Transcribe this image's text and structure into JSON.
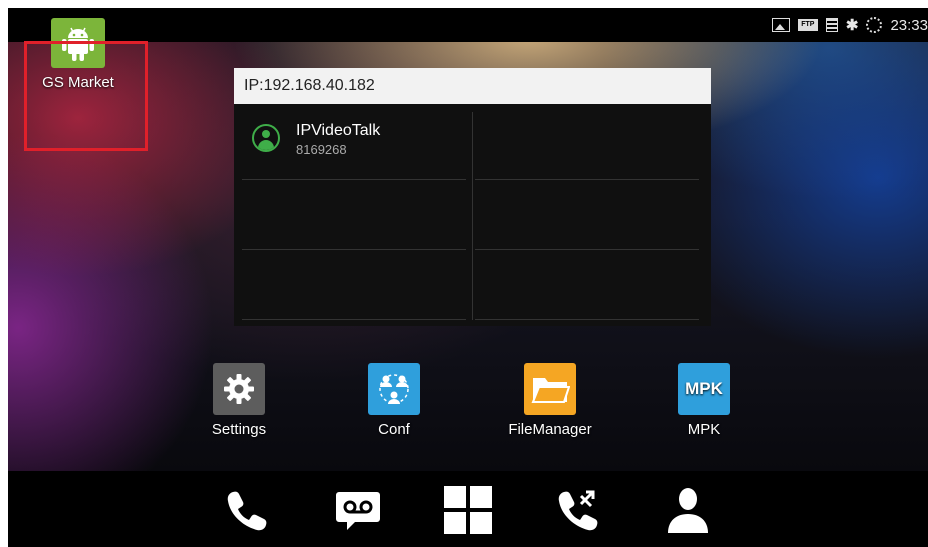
{
  "status_bar": {
    "icons": [
      "image-icon",
      "ftp-icon",
      "calendar-icon",
      "bluetooth-icon",
      "sync-icon"
    ],
    "ftp_label": "FTP",
    "time": "23:33"
  },
  "desktop_shortcut": {
    "label": "GS Market",
    "icon": "android-icon"
  },
  "contacts_widget": {
    "ip_label": "IP:192.168.40.182",
    "contacts": [
      {
        "name": "IPVideoTalk",
        "number": "8169268"
      }
    ]
  },
  "apps": [
    {
      "label": "Settings",
      "icon": "gear-icon",
      "color": "#5d5d5d"
    },
    {
      "label": "Conf",
      "icon": "conference-icon",
      "color": "#2f9fdc"
    },
    {
      "label": "FileManager",
      "icon": "folder-icon",
      "color": "#f5a623"
    },
    {
      "label": "MPK",
      "icon": "mpk-icon",
      "color": "#2f9fdc",
      "tile_text": "MPK"
    }
  ],
  "bottom_bar": [
    "phone-icon",
    "voicemail-icon",
    "apps-grid-icon",
    "call-forward-icon",
    "contacts-icon"
  ],
  "colors": {
    "highlight": "#e0202a",
    "android_green": "#7cb53a",
    "contact_green": "#3fae49"
  }
}
